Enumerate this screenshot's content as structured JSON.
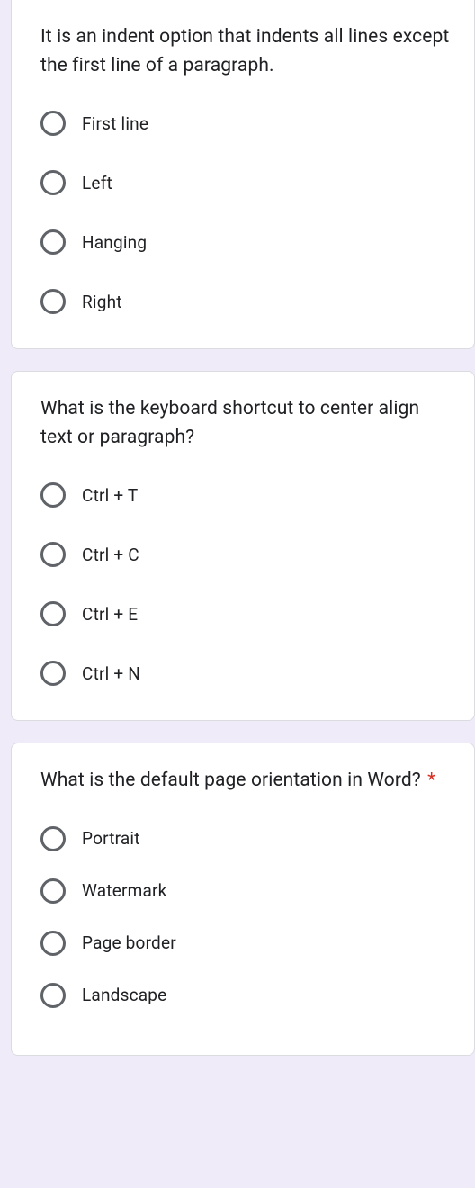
{
  "questions": [
    {
      "prompt": "It is an indent option that indents all lines except the first line of a paragraph.",
      "required": false,
      "options": [
        "First line",
        "Left",
        "Hanging",
        "Right"
      ]
    },
    {
      "prompt": "What is the keyboard shortcut to center align text or paragraph?",
      "required": false,
      "options": [
        "Ctrl + T",
        "Ctrl + C",
        "Ctrl + E",
        "Ctrl + N"
      ]
    },
    {
      "prompt": "What is the default page orientation in Word?",
      "required": true,
      "options": [
        "Portrait",
        "Watermark",
        "Page border",
        "Landscape"
      ]
    }
  ]
}
